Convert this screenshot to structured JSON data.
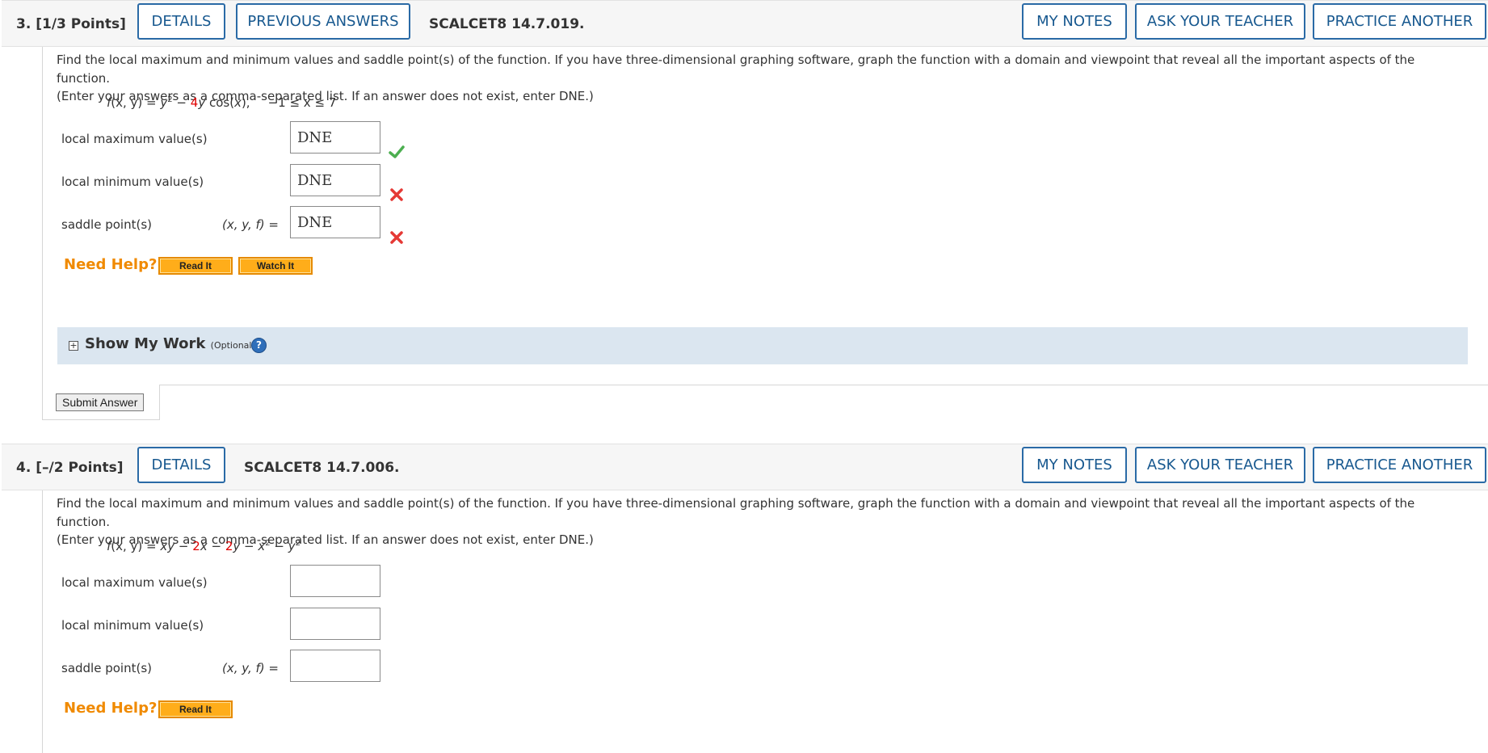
{
  "q3": {
    "number": "3.",
    "points": "[1/3 Points]",
    "details": "DETAILS",
    "previous_answers": "PREVIOUS ANSWERS",
    "code": "SCALCET8 14.7.019.",
    "my_notes": "MY NOTES",
    "ask_teacher": "ASK YOUR TEACHER",
    "practice_another": "PRACTICE ANOTHER",
    "prompt_line1": "Find the local maximum and minimum values and saddle point(s) of the function. If you have three-dimensional graphing software, graph the function with a domain and viewpoint that reveal all the important aspects of the function.",
    "prompt_line2": "(Enter your answers as a comma-separated list. If an answer does not exist, enter DNE.)",
    "formula": {
      "f": "f",
      "args": "(x, y) = ",
      "y1": "y",
      "exp": "2",
      "minus": " − ",
      "coef": "4",
      "y2": "y",
      "cos": " cos(",
      "x": "x",
      "close": "),",
      "domain": "−1 ≤ x ≤ 7"
    },
    "fields": [
      {
        "label": "local maximum value(s)",
        "value": "DNE",
        "status": "correct"
      },
      {
        "label": "local minimum value(s)",
        "value": "DNE",
        "status": "incorrect"
      },
      {
        "label": "saddle point(s)",
        "prefix": "(x, y, f) =",
        "value": "DNE",
        "status": "incorrect"
      }
    ],
    "need_help": "Need Help?",
    "read_it": "Read It",
    "watch_it": "Watch It",
    "show_my_work": "Show My Work",
    "optional": "(Optional)",
    "help_q": "?",
    "submit": "Submit Answer"
  },
  "q4": {
    "number": "4.",
    "points": "[–/2 Points]",
    "details": "DETAILS",
    "code": "SCALCET8 14.7.006.",
    "my_notes": "MY NOTES",
    "ask_teacher": "ASK YOUR TEACHER",
    "practice_another": "PRACTICE ANOTHER",
    "prompt_line1": "Find the local maximum and minimum values and saddle point(s) of the function. If you have three-dimensional graphing software, graph the function with a domain and viewpoint that reveal all the important aspects of the function.",
    "prompt_line2": "(Enter your answers as a comma-separated list. If an answer does not exist, enter DNE.)",
    "formula": {
      "f": "f",
      "args": "(x, y) = ",
      "xy": "xy",
      "m1": " − ",
      "c1": "2",
      "x": "x",
      "m2": " − ",
      "c2": "2",
      "y": "y",
      "m3": " − ",
      "x2": "x",
      "e1": "2",
      "m4": " − ",
      "y2": "y",
      "e2": "2"
    },
    "fields": [
      {
        "label": "local maximum value(s)",
        "value": ""
      },
      {
        "label": "local minimum value(s)",
        "value": ""
      },
      {
        "label": "saddle point(s)",
        "prefix": "(x, y, f) =",
        "value": ""
      }
    ],
    "need_help": "Need Help?",
    "read_it": "Read It"
  },
  "colors": {
    "accent": "#17588f",
    "need_help": "#f08a00",
    "correct": "#4caf50",
    "incorrect": "#e53935",
    "formula_red": "#e00000"
  }
}
